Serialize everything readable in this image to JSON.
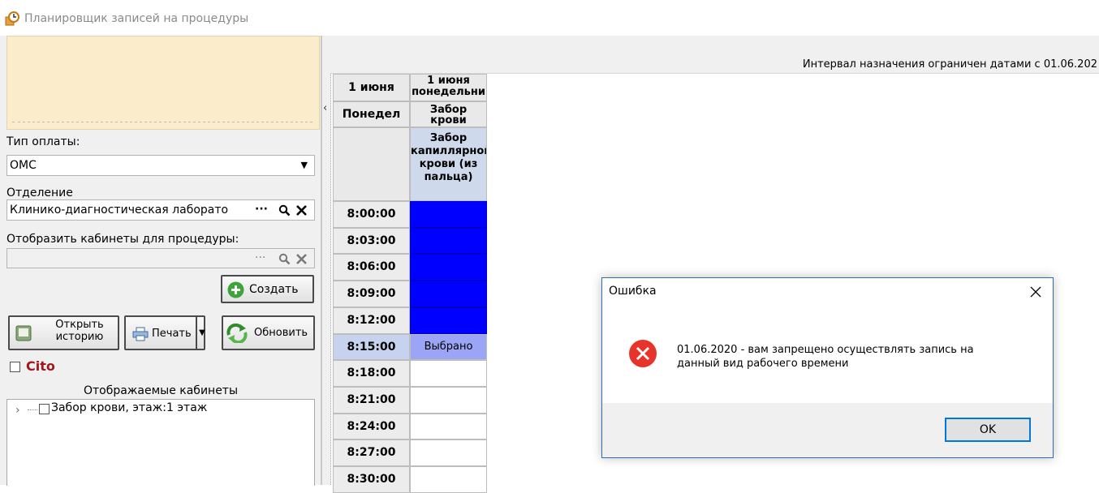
{
  "window": {
    "title": "Планировщик записей на процедуры"
  },
  "left_panel": {
    "payment_type_label": "Тип оплаты:",
    "payment_type_value": "ОМС",
    "department_label": "Отделение",
    "department_value": "Клинико-диагностическая лаборато",
    "ellipsis": "···",
    "cabinets_for_procedure_label": "Отобразить кабинеты для процедуры:",
    "create_button": "Создать",
    "open_history_button": "Открыть историю",
    "print_button": "Печать",
    "refresh_button": "Обновить",
    "cito_label": "Cito",
    "displayed_cabinets_header": "Отображаемые кабинеты",
    "cabinet_item": "Забор крови, этаж:1 этаж"
  },
  "schedule": {
    "interval_notice": "Интервал назначения ограничен датами с 01.06.202",
    "date_col_header": "1 июня",
    "day_col_header": "Понедел",
    "proc_col_date": "1 июня понедельни",
    "proc_col_short": "Забор крови",
    "proc_col_full": "Забор капиллярной крови (из пальца)",
    "times": [
      "8:00:00",
      "8:03:00",
      "8:06:00",
      "8:09:00",
      "8:12:00",
      "8:15:00",
      "8:18:00",
      "8:21:00",
      "8:24:00",
      "8:27:00",
      "8:30:00"
    ],
    "slot_states": [
      "busy",
      "busy",
      "busy",
      "busy",
      "busy",
      "selected",
      "free",
      "free",
      "free",
      "free",
      "free"
    ],
    "selected_label": "Выбрано",
    "colors": {
      "busy": "#0000ff",
      "selected": "#9aa6f5",
      "free": "#ffffff",
      "time_selected": "#c7d2ee"
    }
  },
  "dialog": {
    "title": "Ошибка",
    "message_line1": "01.06.2020 - вам запрещено осуществлять запись на",
    "message_line2": "данный  вид рабочего времени",
    "ok_button": "OK",
    "icon": "error-icon"
  }
}
